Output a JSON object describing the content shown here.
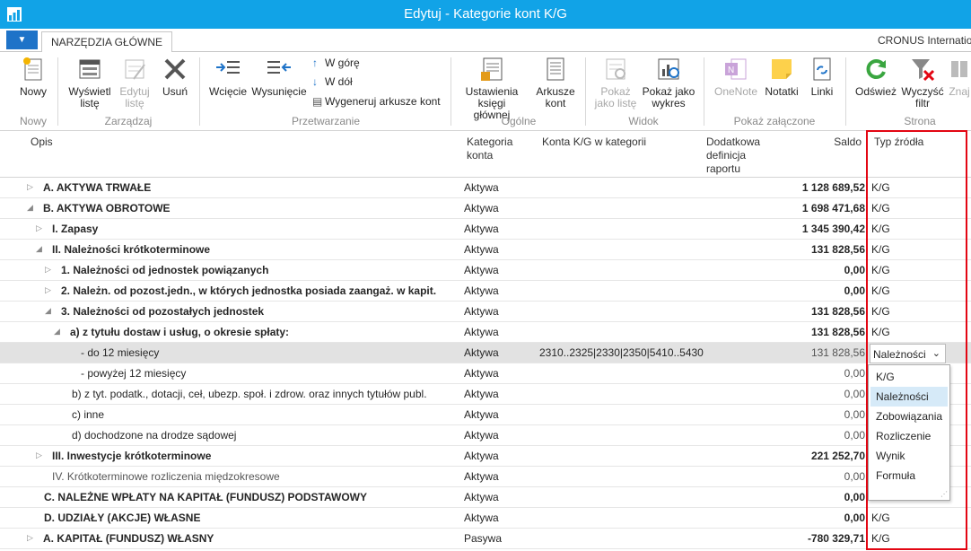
{
  "window": {
    "title": "Edytuj - Kategorie kont K/G"
  },
  "tabs": {
    "menu_label": "▼",
    "home_tab": "NARZĘDZIA GŁÓWNE",
    "company": "CRONUS Internatio"
  },
  "ribbon": {
    "buttons": {
      "nowy": "Nowy",
      "wyswietl": "Wyświetl listę",
      "edytuj": "Edytuj listę",
      "usun": "Usuń",
      "wciecie": "Wcięcie",
      "wysuniecie": "Wysunięcie",
      "w_gore": "W górę",
      "w_dol": "W dół",
      "wygeneruj": "Wygeneruj arkusze kont",
      "ustawienia": "Ustawienia księgi głównej",
      "arkusze": "Arkusze kont",
      "pokaz_liste": "Pokaż jako listę",
      "pokaz_wykres": "Pokaż jako wykres",
      "onenote": "OneNote",
      "notatki": "Notatki",
      "linki": "Linki",
      "odswiez": "Odśwież",
      "wyczysc": "Wyczyść filtr",
      "znajdz": "Znaj"
    },
    "groups": {
      "nowy": "Nowy",
      "zarzadzaj": "Zarządzaj",
      "przetwarzanie": "Przetwarzanie",
      "ogolne": "Ogólne",
      "widok": "Widok",
      "zalaczone": "Pokaż załączone",
      "strona": "Strona"
    }
  },
  "grid": {
    "columns": {
      "opis": "Opis",
      "kategoria": "Kategoria konta",
      "konta": "Konta K/G w kategorii",
      "dodatkowa": "Dodatkowa definicja raportu",
      "saldo": "Saldo",
      "typ": "Typ źródła"
    },
    "rows": [
      {
        "opis": "A. AKTYWA TRWAŁE",
        "kategoria": "Aktywa",
        "konta": "",
        "saldo": "1 128 689,52",
        "typ": "K/G",
        "expander": "▷"
      },
      {
        "opis": "B. AKTYWA OBROTOWE",
        "kategoria": "Aktywa",
        "konta": "",
        "saldo": "1 698 471,68",
        "typ": "K/G",
        "expander": "◢"
      },
      {
        "opis": "I. Zapasy",
        "kategoria": "Aktywa",
        "konta": "",
        "saldo": "1 345 390,42",
        "typ": "K/G",
        "expander": "▷"
      },
      {
        "opis": "II. Należności krótkoterminowe",
        "kategoria": "Aktywa",
        "konta": "",
        "saldo": "131 828,56",
        "typ": "K/G",
        "expander": "◢"
      },
      {
        "opis": "1. Należności od jednostek powiązanych",
        "kategoria": "Aktywa",
        "konta": "",
        "saldo": "0,00",
        "typ": "K/G",
        "expander": "▷"
      },
      {
        "opis": "2. Należn. od pozost.jedn., w których jednostka posiada zaangaż. w kapit.",
        "kategoria": "Aktywa",
        "konta": "",
        "saldo": "0,00",
        "typ": "K/G",
        "expander": "▷"
      },
      {
        "opis": "3. Należności od pozostałych jednostek",
        "kategoria": "Aktywa",
        "konta": "",
        "saldo": "131 828,56",
        "typ": "K/G",
        "expander": "◢"
      },
      {
        "opis": "a) z tytułu dostaw i usług, o okresie spłaty:",
        "kategoria": "Aktywa",
        "konta": "",
        "saldo": "131 828,56",
        "typ": "K/G",
        "expander": "◢"
      },
      {
        "opis": "- do 12 miesięcy",
        "kategoria": "Aktywa",
        "konta": "2310..2325|2330|2350|5410..5430",
        "saldo": "131 828,56",
        "typ": "Należności",
        "expander": ""
      },
      {
        "opis": "- powyżej 12 miesięcy",
        "kategoria": "Aktywa",
        "konta": "",
        "saldo": "0,00",
        "typ": "",
        "expander": ""
      },
      {
        "opis": "b) z tyt. podatk., dotacji, ceł, ubezp. społ. i zdrow. oraz innych tytułów publ.",
        "kategoria": "Aktywa",
        "konta": "",
        "saldo": "0,00",
        "typ": "",
        "expander": ""
      },
      {
        "opis": "c) inne",
        "kategoria": "Aktywa",
        "konta": "",
        "saldo": "0,00",
        "typ": "",
        "expander": ""
      },
      {
        "opis": "d) dochodzone na drodze sądowej",
        "kategoria": "Aktywa",
        "konta": "",
        "saldo": "0,00",
        "typ": "",
        "expander": ""
      },
      {
        "opis": "III. Inwestycje krótkoterminowe",
        "kategoria": "Aktywa",
        "konta": "",
        "saldo": "221 252,70",
        "typ": "",
        "expander": "▷"
      },
      {
        "opis": "IV. Krótkoterminowe rozliczenia międzokresowe",
        "kategoria": "Aktywa",
        "konta": "",
        "saldo": "0,00",
        "typ": "",
        "expander": ""
      },
      {
        "opis": "C. NALEŻNE WPŁATY NA KAPITAŁ (FUNDUSZ) PODSTAWOWY",
        "kategoria": "Aktywa",
        "konta": "",
        "saldo": "0,00",
        "typ": "",
        "expander": ""
      },
      {
        "opis": "D. UDZIAŁY (AKCJE) WŁASNE",
        "kategoria": "Aktywa",
        "konta": "",
        "saldo": "0,00",
        "typ": "K/G",
        "expander": ""
      },
      {
        "opis": "A. KAPITAŁ (FUNDUSZ) WŁASNY",
        "kategoria": "Pasywa",
        "konta": "",
        "saldo": "-780 329,71",
        "typ": "K/G",
        "expander": "▷"
      }
    ]
  },
  "dropdown": {
    "selected": "Należności",
    "chevron": "⌄",
    "options": [
      "K/G",
      "Należności",
      "Zobowiązania",
      "Rozliczenie",
      "Wynik",
      "Formuła"
    ],
    "highlighted_index": 1
  },
  "colors": {
    "titlebar": "#11a3e7",
    "highlight_frame": "#e30613",
    "selected_row": "#e2e2e2"
  }
}
